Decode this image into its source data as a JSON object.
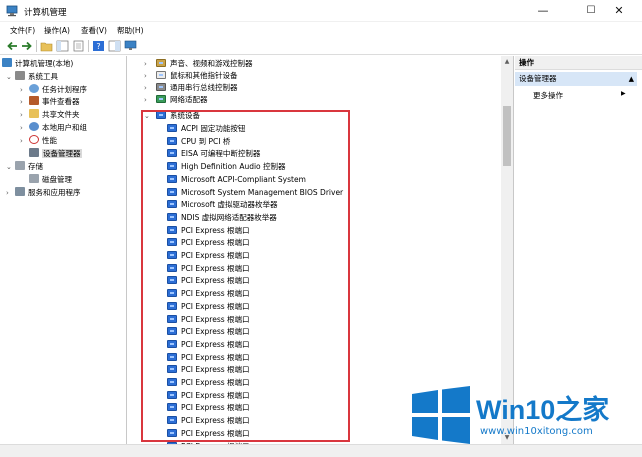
{
  "window": {
    "title": "计算机管理",
    "minimize": "—",
    "maximize": "☐",
    "close": "✕"
  },
  "menu": [
    "文件(F)",
    "操作(A)",
    "查看(V)",
    "帮助(H)"
  ],
  "tree": {
    "root": "计算机管理(本地)",
    "system_tools": "系统工具",
    "task_scheduler": "任务计划程序",
    "event_viewer": "事件查看器",
    "shared_folders": "共享文件夹",
    "local_users": "本地用户和组",
    "performance": "性能",
    "device_manager": "设备管理器",
    "storage": "存储",
    "disk_management": "磁盘管理",
    "services": "服务和应用程序"
  },
  "devices": {
    "top_categories": [
      "声音、视频和游戏控制器",
      "鼠标和其他指针设备",
      "通用串行总线控制器",
      "网络适配器"
    ],
    "system_devices": "系统设备",
    "items": [
      "ACPI 固定功能按钮",
      "CPU 到 PCI 桥",
      "EISA 可编程中断控制器",
      "High Definition Audio 控制器",
      "Microsoft ACPI-Compliant System",
      "Microsoft System Management BIOS Driver",
      "Microsoft 虚拟驱动器枚举器",
      "NDIS 虚拟网络适配器枚举器",
      "PCI Express 根端口",
      "PCI Express 根端口",
      "PCI Express 根端口",
      "PCI Express 根端口",
      "PCI Express 根端口",
      "PCI Express 根端口",
      "PCI Express 根端口",
      "PCI Express 根端口",
      "PCI Express 根端口",
      "PCI Express 根端口",
      "PCI Express 根端口",
      "PCI Express 根端口",
      "PCI Express 根端口",
      "PCI Express 根端口",
      "PCI Express 根端口",
      "PCI Express 根端口",
      "PCI Express 根端口",
      "PCI Express 根端口",
      "PCI Express 根端口"
    ]
  },
  "actions": {
    "header": "操作",
    "device_manager": "设备管理器",
    "more": "更多操作",
    "collapse": "▲",
    "more_chevron": "▶"
  },
  "watermark": {
    "title": "Win10之家",
    "url": "www.win10xitong.com"
  },
  "colors": {
    "highlight": "#d9363e",
    "brand": "#1479c9",
    "device_icon": "#2c6ed5"
  }
}
